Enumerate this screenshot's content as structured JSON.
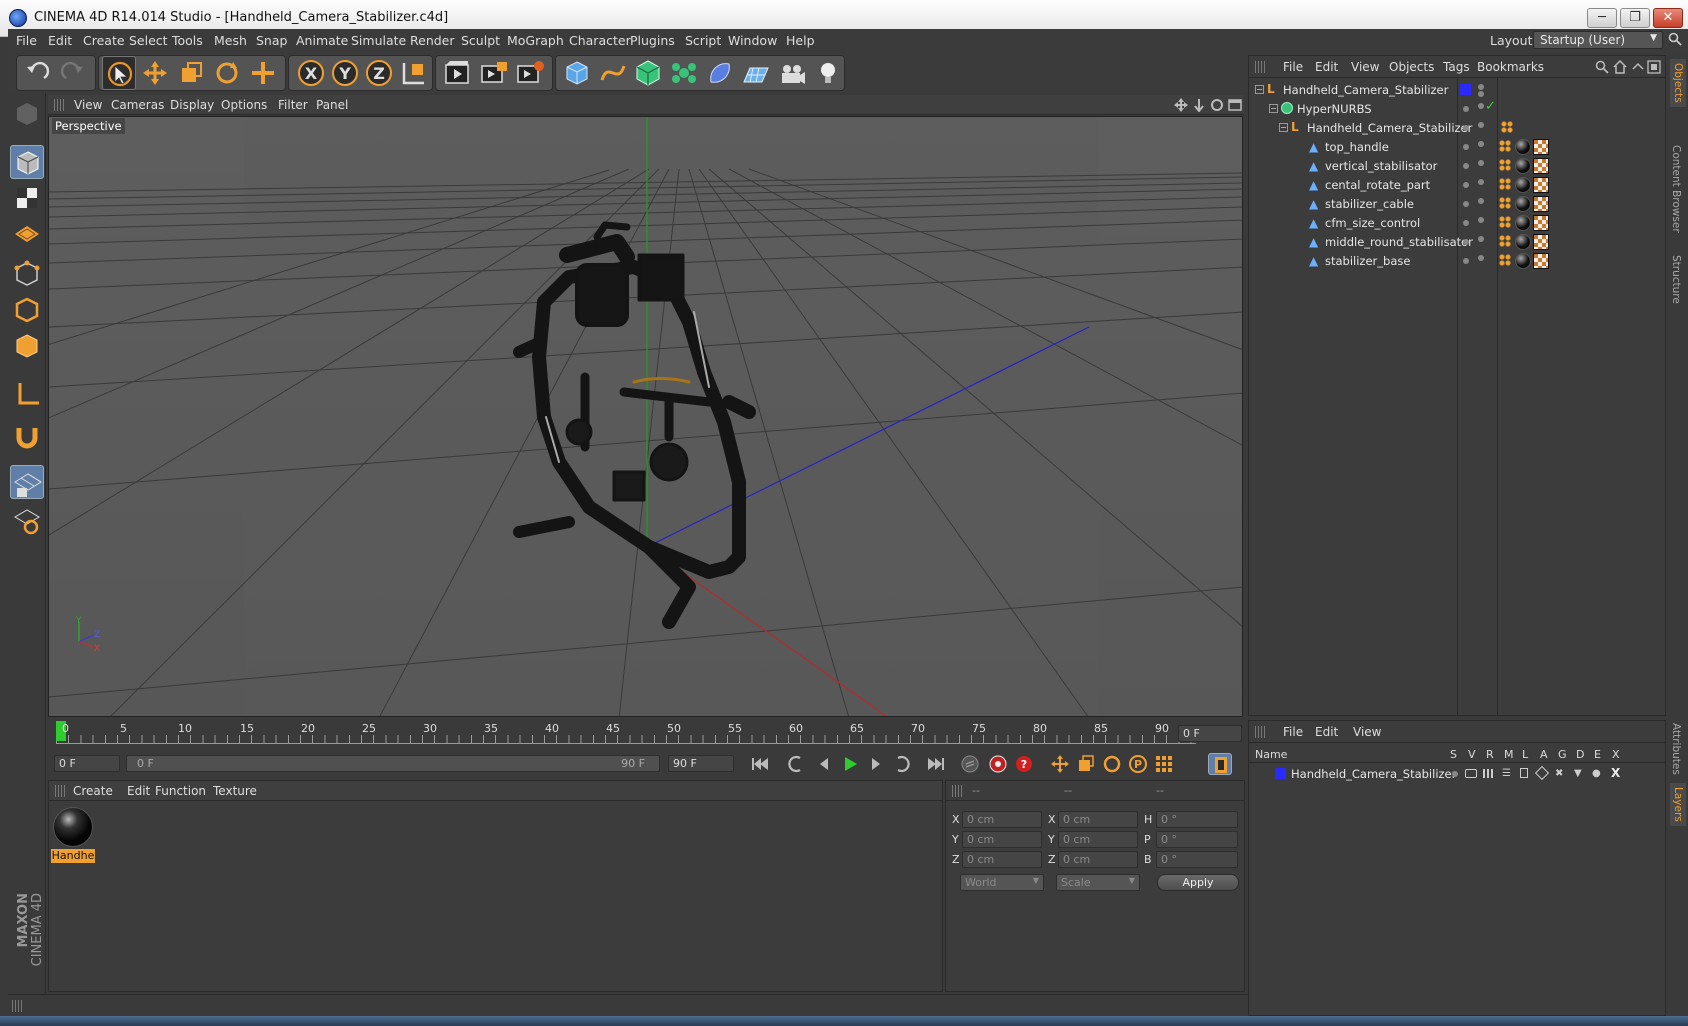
{
  "window": {
    "title": "CINEMA 4D R14.014 Studio - [Handheld_Camera_Stabilizer.c4d]",
    "minimize": "─",
    "restore": "❐",
    "close": "✕"
  },
  "menu": [
    "File",
    "Edit",
    "Create",
    "Select",
    "Tools",
    "Mesh",
    "Snap",
    "Animate",
    "Simulate",
    "Render",
    "Sculpt",
    "MoGraph",
    "Character",
    "Plugins",
    "Script",
    "Window",
    "Help"
  ],
  "layout": {
    "label": "Layout:",
    "value": "Startup (User)"
  },
  "viewport": {
    "menu": [
      "View",
      "Cameras",
      "Display",
      "Options",
      "Filter",
      "Panel"
    ],
    "label": "Perspective",
    "axis_y": "Y",
    "axis_z": "Z",
    "axis_x": "X"
  },
  "objects_panel": {
    "menu": [
      "File",
      "Edit",
      "View",
      "Objects",
      "Tags",
      "Bookmarks"
    ],
    "items": [
      {
        "name": "Handheld_Camera_Stabilizer",
        "level": 0
      },
      {
        "name": "HyperNURBS",
        "level": 1
      },
      {
        "name": "Handheld_Camera_Stabilizer",
        "level": 2
      },
      {
        "name": "top_handle",
        "level": 3
      },
      {
        "name": "vertical_stabilisator",
        "level": 3
      },
      {
        "name": "cental_rotate_part",
        "level": 3
      },
      {
        "name": "stabilizer_cable",
        "level": 3
      },
      {
        "name": "cfm_size_control",
        "level": 3
      },
      {
        "name": "middle_round_stabilisator",
        "level": 3
      },
      {
        "name": "stabilizer_base",
        "level": 3
      }
    ]
  },
  "timeline": {
    "ticks": [
      "0",
      "5",
      "10",
      "15",
      "20",
      "25",
      "30",
      "35",
      "40",
      "45",
      "50",
      "55",
      "60",
      "65",
      "70",
      "75",
      "80",
      "85",
      "90"
    ],
    "frame_field": "0 F",
    "start_field": "0 F",
    "range_start": "0 F",
    "range_end": "90 F",
    "end_field": "90 F"
  },
  "materials": {
    "menu": [
      "Create",
      "Edit",
      "Function",
      "Texture"
    ],
    "items": [
      {
        "label": "Handhe"
      }
    ]
  },
  "coords": {
    "headers": [
      "--",
      "--",
      "--"
    ],
    "rows": [
      {
        "a": "X",
        "av": "0 cm",
        "b": "X",
        "bv": "0 cm",
        "c": "H",
        "cv": "0 °"
      },
      {
        "a": "Y",
        "av": "0 cm",
        "b": "Y",
        "bv": "0 cm",
        "c": "P",
        "cv": "0 °"
      },
      {
        "a": "Z",
        "av": "0 cm",
        "b": "Z",
        "bv": "0 cm",
        "c": "B",
        "cv": "0 °"
      }
    ],
    "mode1": "World",
    "mode2": "Scale",
    "apply": "Apply"
  },
  "layers": {
    "menu": [
      "File",
      "Edit",
      "View"
    ],
    "name_header": "Name",
    "flags": [
      "S",
      "V",
      "R",
      "M",
      "L",
      "A",
      "G",
      "D",
      "E",
      "X"
    ],
    "items": [
      {
        "name": "Handheld_Camera_Stabilizer"
      }
    ]
  },
  "right_tabs": [
    "Objects",
    "Content Browser",
    "Structure",
    "Attributes",
    "Layers"
  ],
  "branding": {
    "line1": "MAXON",
    "line2": "CINEMA 4D"
  },
  "colors": {
    "accent": "#f0a030",
    "layer_blue": "#2a2aff",
    "play_green": "#2ecc2e"
  }
}
